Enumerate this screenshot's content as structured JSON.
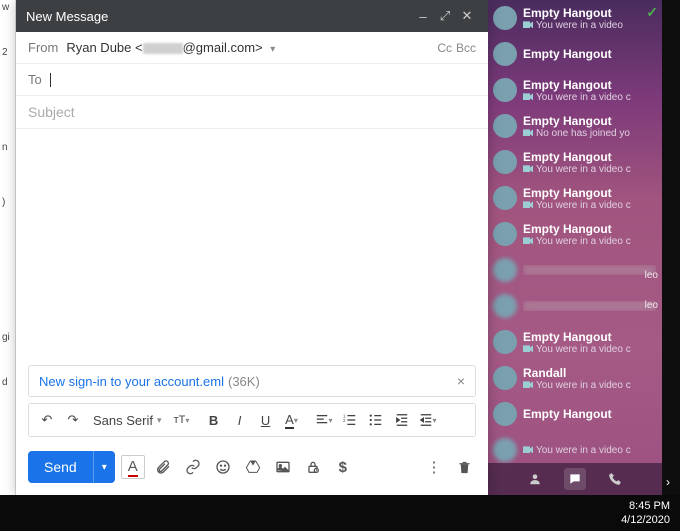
{
  "compose": {
    "title": "New Message",
    "from_label": "From",
    "from_name": "Ryan Dube",
    "from_email_visible": "@gmail.com>",
    "to_label": "To",
    "cc_label": "Cc",
    "bcc_label": "Bcc",
    "subject_placeholder": "Subject",
    "attachment": {
      "name": "New sign-in to your account.eml",
      "size": "(36K)"
    },
    "font_family": "Sans Serif",
    "send_label": "Send"
  },
  "hangouts": {
    "items": [
      {
        "title": "Empty Hangout",
        "sub": "You were in a video"
      },
      {
        "title": "Empty Hangout",
        "sub": ""
      },
      {
        "title": "Empty Hangout",
        "sub": "You were in a video c"
      },
      {
        "title": "Empty Hangout",
        "sub": "No one has joined yo"
      },
      {
        "title": "Empty Hangout",
        "sub": "You were in a video c"
      },
      {
        "title": "Empty Hangout",
        "sub": "You were in a video c"
      },
      {
        "title": "Empty Hangout",
        "sub": "You were in a video c"
      },
      {
        "title": "",
        "sub": ""
      },
      {
        "title": "",
        "sub": ""
      },
      {
        "title": "Empty Hangout",
        "sub": "You were in a video c"
      },
      {
        "title": "Randall",
        "sub": "You were in a video c"
      },
      {
        "title": "Empty Hangout",
        "sub": ""
      },
      {
        "title": "",
        "sub": "You were in a video c"
      }
    ],
    "tail1": "leo",
    "tail2": "leo"
  },
  "taskbar": {
    "time": "8:45 PM",
    "date": "4/12/2020"
  }
}
